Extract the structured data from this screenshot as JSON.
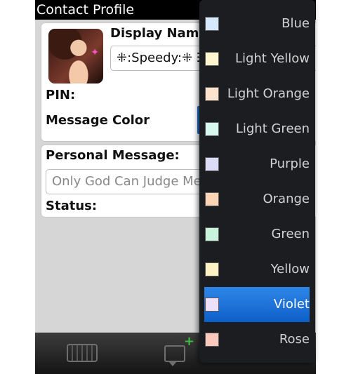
{
  "title": "Contact Profile",
  "profile": {
    "display_name_label": "Display Nam",
    "display_name_value": "⁜:Speedy:⁜ ☷",
    "pin_label": "PIN:",
    "message_color_label": "Message Color",
    "personal_message_label": "Personal Message:",
    "personal_message_value": "Only God Can Judge Me",
    "status_label": "Status:"
  },
  "color_menu": {
    "items": [
      {
        "label": "Blue",
        "color": "#d6e8fb"
      },
      {
        "label": "Light Yellow",
        "color": "#fdf6cf"
      },
      {
        "label": "Light Orange",
        "color": "#fce3cd"
      },
      {
        "label": "Light Green",
        "color": "#d7f8ef"
      },
      {
        "label": "Purple",
        "color": "#dcdcf8"
      },
      {
        "label": "Orange",
        "color": "#fcd4b6"
      },
      {
        "label": "Green",
        "color": "#c8f4dc"
      },
      {
        "label": "Yellow",
        "color": "#fdf3c2"
      },
      {
        "label": "Violet",
        "color": "#ece0fb"
      },
      {
        "label": "Rose",
        "color": "#fbcabd"
      }
    ],
    "selected": "Violet"
  },
  "colors": {
    "accent": "#1a6fd6",
    "menu_bg": "#1b1d21",
    "titlebar_bg": "#000000"
  }
}
